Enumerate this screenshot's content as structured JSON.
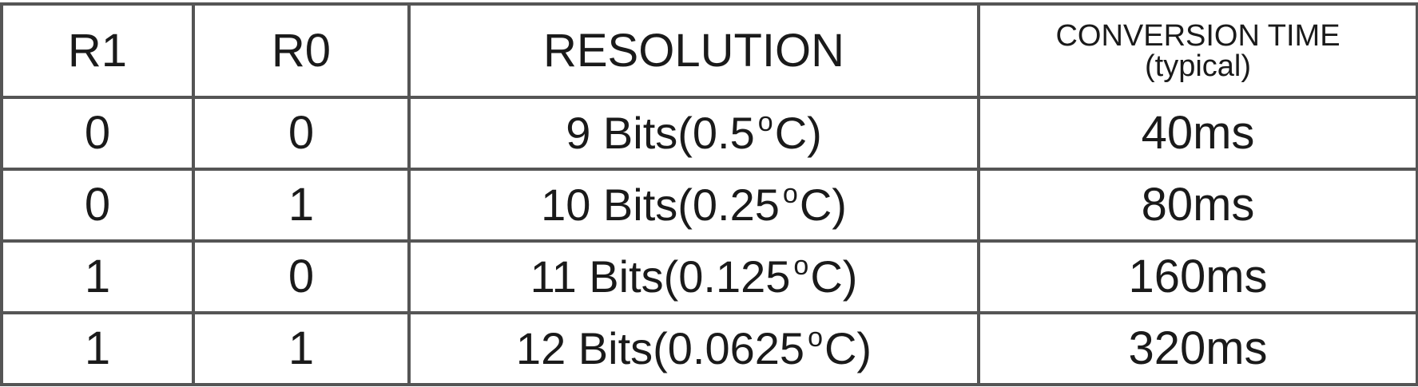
{
  "table": {
    "headers": {
      "r1": "R1",
      "r0": "R0",
      "resolution": "RESOLUTION",
      "conversion_line1": "CONVERSION TIME",
      "conversion_line2": "(typical)"
    },
    "rows": [
      {
        "r1": "0",
        "r0": "0",
        "res_prefix": "9 Bits(0.5",
        "deg": "o",
        "res_suffix": "C)",
        "time": "40ms"
      },
      {
        "r1": "0",
        "r0": "1",
        "res_prefix": "10 Bits(0.25",
        "deg": "o",
        "res_suffix": "C)",
        "time": "80ms"
      },
      {
        "r1": "1",
        "r0": "0",
        "res_prefix": "11 Bits(0.125",
        "deg": "o",
        "res_suffix": "C)",
        "time": "160ms"
      },
      {
        "r1": "1",
        "r0": "1",
        "res_prefix": "12 Bits(0.0625",
        "deg": "o",
        "res_suffix": "C)",
        "time": "320ms"
      }
    ]
  },
  "colors": {
    "border": "#555555",
    "text": "#1a1a1a",
    "background": "#ffffff"
  }
}
